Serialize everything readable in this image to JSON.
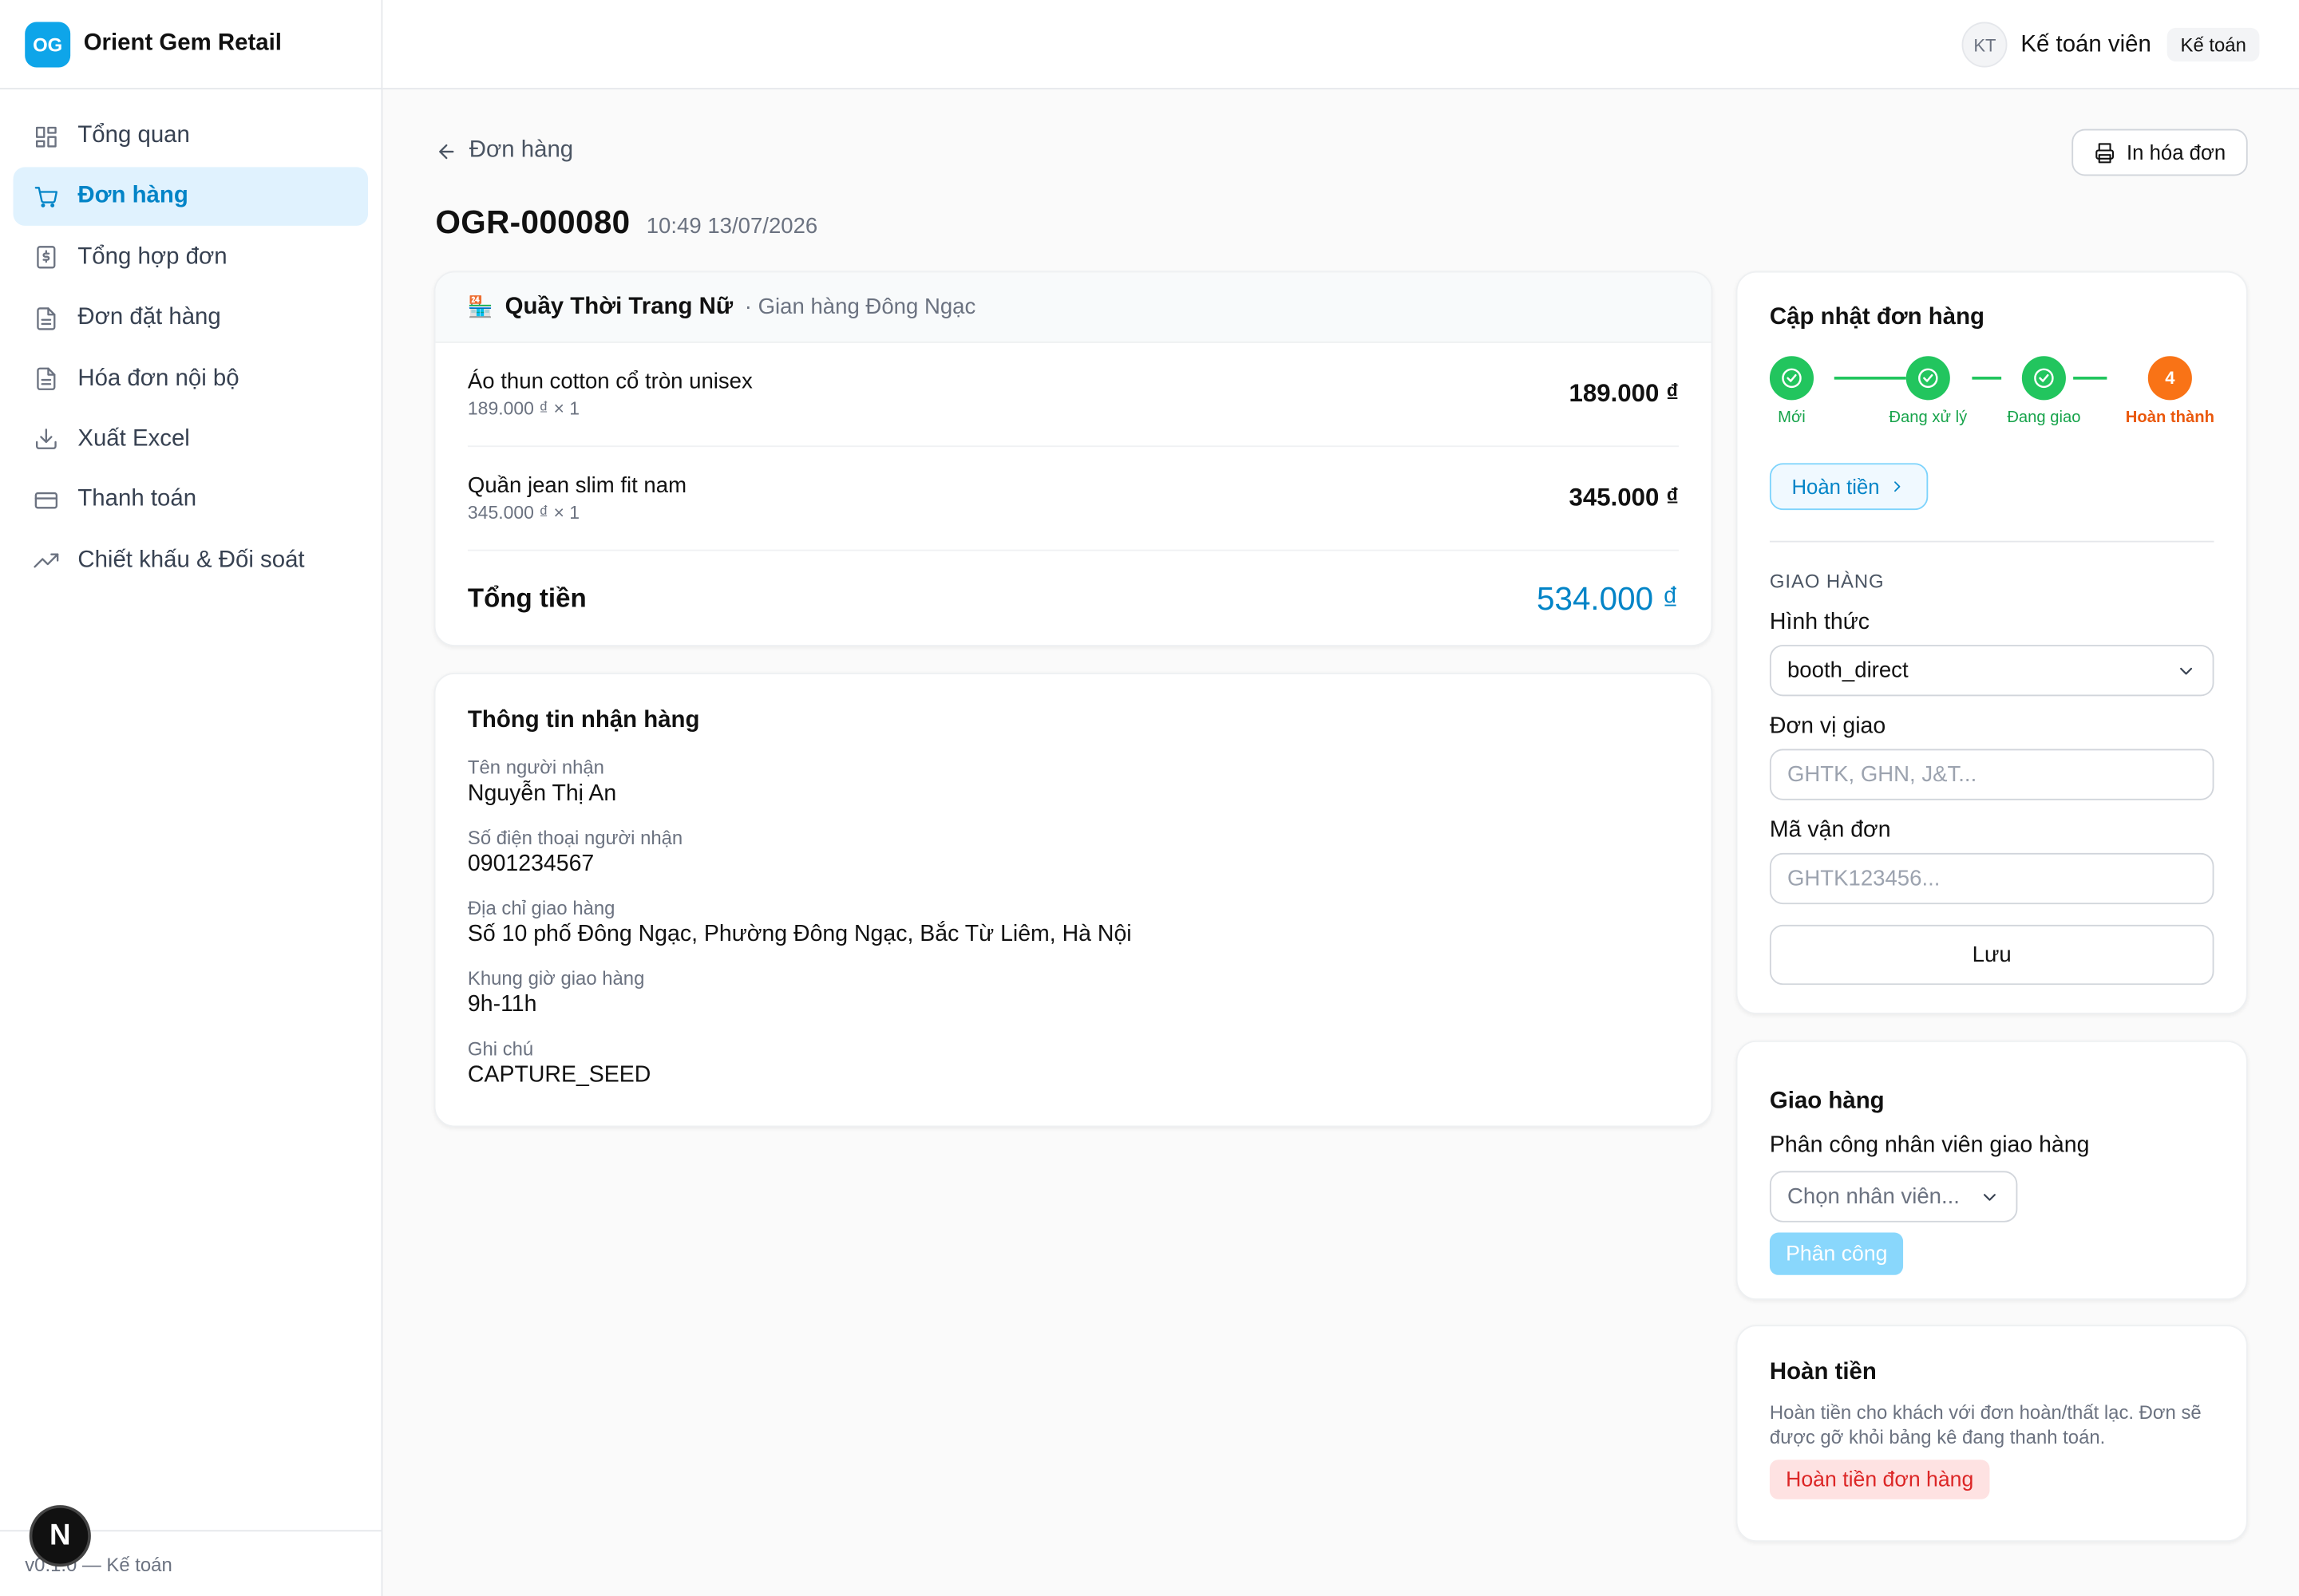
{
  "brand": {
    "logo": "OG",
    "name": "Orient Gem Retail"
  },
  "sidebar": {
    "items": [
      {
        "label": "Tổng quan",
        "icon": "dashboard-icon"
      },
      {
        "label": "Đơn hàng",
        "icon": "cart-icon",
        "active": true
      },
      {
        "label": "Tổng hợp đơn",
        "icon": "receipt-dollar-icon"
      },
      {
        "label": "Đơn đặt hàng",
        "icon": "document-icon"
      },
      {
        "label": "Hóa đơn nội bộ",
        "icon": "document-icon"
      },
      {
        "label": "Xuất Excel",
        "icon": "download-icon"
      },
      {
        "label": "Thanh toán",
        "icon": "credit-card-icon"
      },
      {
        "label": "Chiết khấu & Đối soát",
        "icon": "trending-up-icon"
      }
    ],
    "footer": "v0.1.0 — Kế toán"
  },
  "topbar": {
    "avatar": "KT",
    "user_name": "Kế toán viên",
    "role": "Kế toán"
  },
  "page": {
    "back_label": "Đơn hàng",
    "print_label": "In hóa đơn",
    "order_code": "OGR-000080",
    "order_time": "10:49 13/07/2026"
  },
  "order": {
    "booth_icon": "🏪",
    "booth_name": "Quầy Thời Trang Nữ",
    "booth_sub": "· Gian hàng Đông Ngạc",
    "items": [
      {
        "name": "Áo thun cotton cổ tròn unisex",
        "meta": "189.000 ₫ × 1",
        "price": "189.000 ₫"
      },
      {
        "name": "Quần jean slim fit nam",
        "meta": "345.000 ₫ × 1",
        "price": "345.000 ₫"
      }
    ],
    "total_label": "Tổng tiền",
    "total_value": "534.000 ₫"
  },
  "receiver": {
    "title": "Thông tin nhận hàng",
    "fields": [
      {
        "label": "Tên người nhận",
        "value": "Nguyễn Thị An"
      },
      {
        "label": "Số điện thoại người nhận",
        "value": "0901234567"
      },
      {
        "label": "Địa chỉ giao hàng",
        "value": "Số 10 phố Đông Ngạc, Phường Đông Ngạc, Bắc Từ Liêm, Hà Nội"
      },
      {
        "label": "Khung giờ giao hàng",
        "value": "9h-11h"
      },
      {
        "label": "Ghi chú",
        "value": "CAPTURE_SEED"
      }
    ]
  },
  "update": {
    "title": "Cập nhật đơn hàng",
    "steps": [
      {
        "label": "Mới",
        "done": true
      },
      {
        "label": "Đang xử lý",
        "done": true
      },
      {
        "label": "Đang giao",
        "done": true
      },
      {
        "label": "Hoàn thành",
        "number": "4",
        "current": true
      }
    ],
    "refund_chip": "Hoàn tiền",
    "section_caption": "GIAO HÀNG",
    "method_label": "Hình thức",
    "method_value": "booth_direct",
    "carrier_label": "Đơn vị giao",
    "carrier_placeholder": "GHTK, GHN, J&T...",
    "tracking_label": "Mã vận đơn",
    "tracking_placeholder": "GHTK123456...",
    "save_label": "Lưu"
  },
  "delivery": {
    "title": "Giao hàng",
    "assign_label": "Phân công nhân viên giao hàng",
    "staff_placeholder": "Chọn nhân viên...",
    "assign_button": "Phân công"
  },
  "refund": {
    "title": "Hoàn tiền",
    "description": "Hoàn tiền cho khách với đơn hoàn/thất lạc. Đơn sẽ được gỡ khỏi bảng kê đang thanh toán.",
    "button": "Hoàn tiền đơn hàng"
  },
  "colors": {
    "accent": "#0284c7",
    "success": "#22c55e",
    "current_step": "#f97316",
    "danger": "#dc2626"
  }
}
